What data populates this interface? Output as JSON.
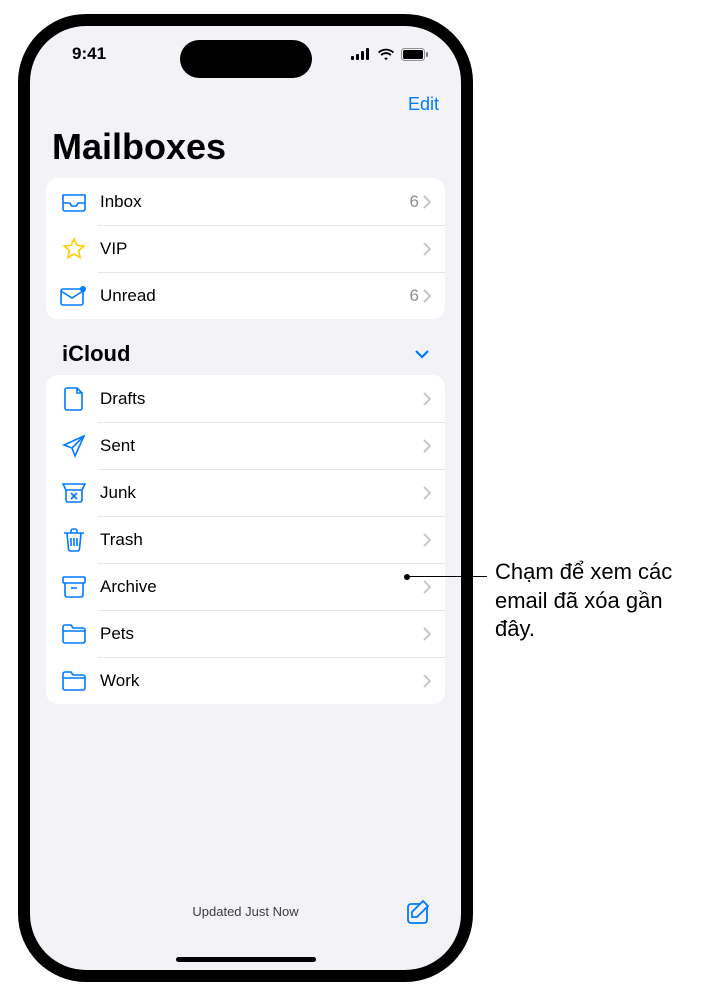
{
  "status": {
    "time": "9:41"
  },
  "nav": {
    "edit": "Edit"
  },
  "title": "Mailboxes",
  "top_mailboxes": [
    {
      "icon": "inbox",
      "label": "Inbox",
      "count": "6"
    },
    {
      "icon": "star",
      "label": "VIP",
      "count": ""
    },
    {
      "icon": "unread",
      "label": "Unread",
      "count": "6"
    }
  ],
  "section": {
    "label": "iCloud"
  },
  "icloud_mailboxes": [
    {
      "icon": "draft",
      "label": "Drafts"
    },
    {
      "icon": "sent",
      "label": "Sent"
    },
    {
      "icon": "junk",
      "label": "Junk"
    },
    {
      "icon": "trash",
      "label": "Trash"
    },
    {
      "icon": "archive",
      "label": "Archive"
    },
    {
      "icon": "folder",
      "label": "Pets"
    },
    {
      "icon": "folder",
      "label": "Work"
    }
  ],
  "toolbar": {
    "status": "Updated Just Now"
  },
  "callout": {
    "text": "Chạm để xem các email đã xóa gần đây."
  }
}
